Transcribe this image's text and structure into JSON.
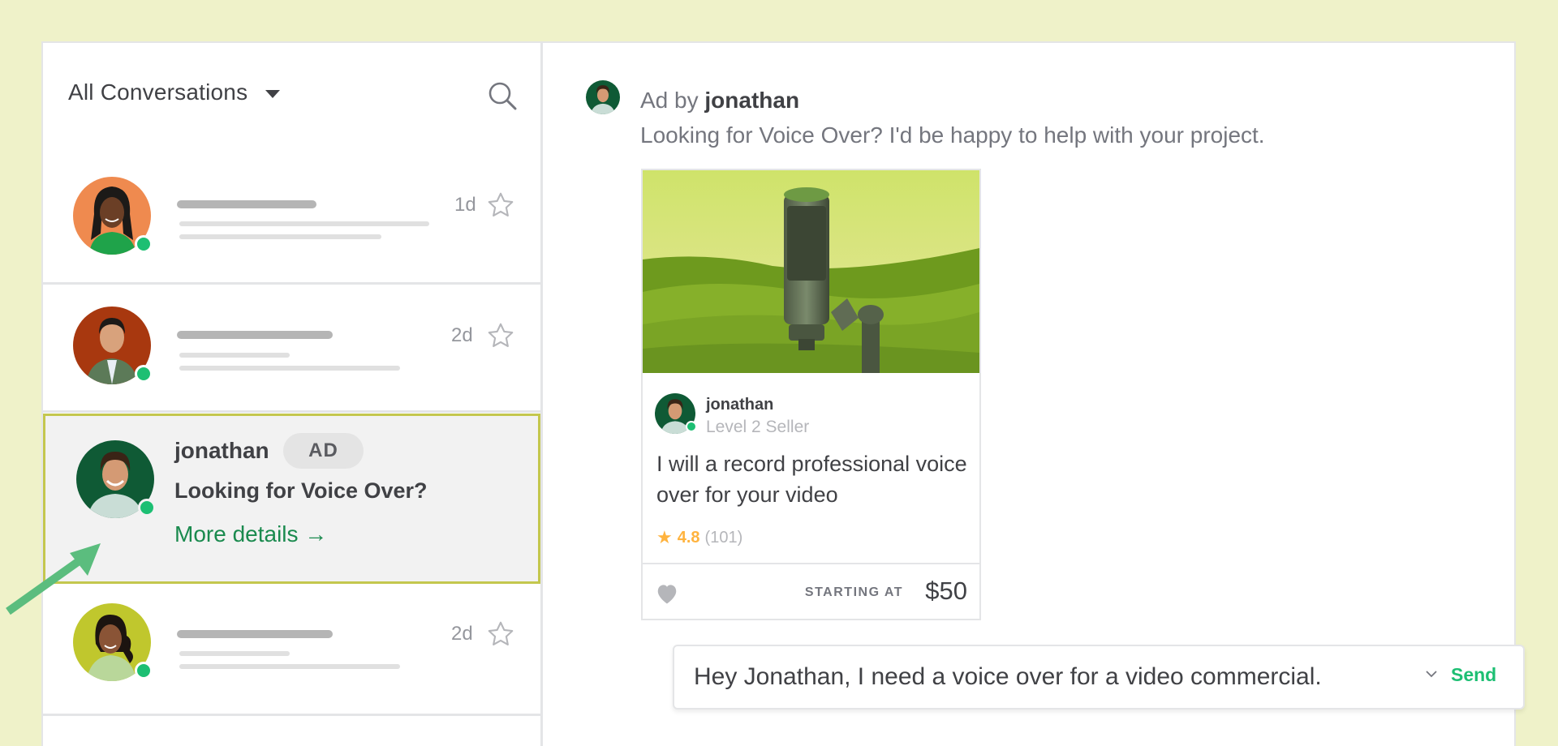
{
  "colors": {
    "page_background": "#eff2c9",
    "accent_green": "#1dbf73",
    "link_green": "#1a8a4e",
    "highlight_border": "#c4c74e",
    "rating_orange": "#ffb33e",
    "annotation_arrow": "#5bbd7e"
  },
  "sidebar": {
    "filter_label": "All Conversations",
    "filter_icon": "caret-down-icon",
    "search_icon": "search-icon",
    "conversations": [
      {
        "avatar_bg": "#ef8a4f",
        "online": true,
        "time": "1d",
        "starred": false,
        "placeholder": true
      },
      {
        "avatar_bg": "#a8380f",
        "online": true,
        "time": "2d",
        "starred": false,
        "placeholder": true
      },
      {
        "avatar_bg": "#0f5a35",
        "online": true,
        "selected": true,
        "name": "jonathan",
        "badge": "AD",
        "subject": "Looking for Voice Over?",
        "link": "More details →"
      },
      {
        "avatar_bg": "#c0c72d",
        "online": true,
        "time": "2d",
        "starred": false,
        "placeholder": true
      }
    ]
  },
  "main": {
    "header_prefix": "Ad by",
    "header_name": "jonathan",
    "message": "Looking for Voice Over? I'd be happy to help with your project.",
    "gig_card": {
      "image_alt": "microphone on green hills",
      "seller_name": "jonathan",
      "seller_level": "Level 2 Seller",
      "title": "I will a record professional voice over for your video",
      "rating": "4.8",
      "reviews": "(101)",
      "price_label": "STARTING AT",
      "price": "$50"
    },
    "composer": {
      "value": "Hey Jonathan, I need a voice over for a video commercial.",
      "send_label": "Send"
    }
  }
}
